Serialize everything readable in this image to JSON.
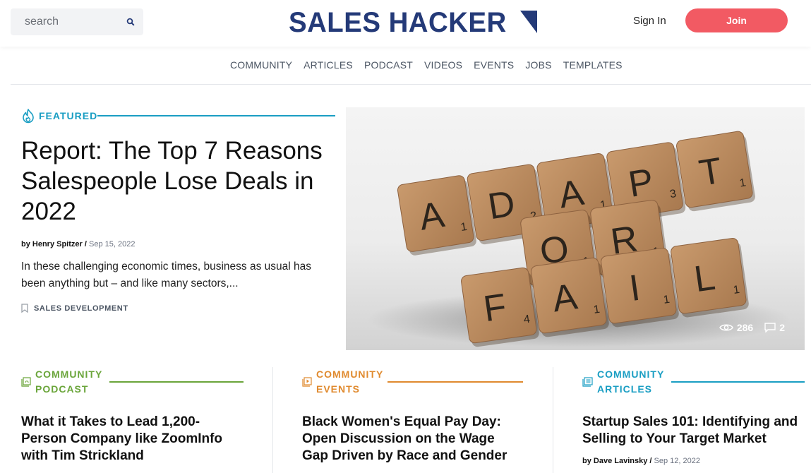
{
  "header": {
    "search_placeholder": "search",
    "logo_text": "SALES HACKER",
    "sign_in": "Sign In",
    "join": "Join"
  },
  "nav": [
    "COMMUNITY",
    "ARTICLES",
    "PODCAST",
    "VIDEOS",
    "EVENTS",
    "JOBS",
    "TEMPLATES"
  ],
  "featured": {
    "label": "FEATURED",
    "title": "Report: The Top 7 Reasons Salespeople Lose Deals in 2022",
    "author": "by Henry Spitzer",
    "date": "Sep 15, 2022",
    "excerpt": "In these challenging economic times, business as usual has been anything but – and like many sectors,...",
    "tag": "SALES DEVELOPMENT",
    "views": "286",
    "comments": "2",
    "image_tiles": {
      "row1": [
        {
          "l": "A",
          "n": "1"
        },
        {
          "l": "D",
          "n": "2"
        },
        {
          "l": "A",
          "n": "1"
        },
        {
          "l": "P",
          "n": "3"
        },
        {
          "l": "T",
          "n": "1"
        }
      ],
      "row2": [
        {
          "l": "O",
          "n": "1"
        },
        {
          "l": "R",
          "n": "1"
        }
      ],
      "row3": [
        {
          "l": "F",
          "n": "4"
        },
        {
          "l": "A",
          "n": "1"
        },
        {
          "l": "I",
          "n": "1"
        },
        {
          "l": "L",
          "n": "1"
        }
      ]
    }
  },
  "cards": [
    {
      "category_line1": "COMMUNITY",
      "category_line2": "PODCAST",
      "color": "#6aa53a",
      "title": "What it Takes to Lead 1,200-Person Company like ZoomInfo with Tim Strickland"
    },
    {
      "category_line1": "COMMUNITY",
      "category_line2": "EVENTS",
      "color": "#e08a2e",
      "title": "Black Women's Equal Pay Day: Open Discussion on the Wage Gap Driven by Race and Gender"
    },
    {
      "category_line1": "COMMUNITY",
      "category_line2": "ARTICLES",
      "color": "#1a9ec3",
      "title": "Startup Sales 101: Identifying and Selling to Your Target Market",
      "author": "by Dave Lavinsky",
      "date": "Sep 12, 2022"
    }
  ],
  "colors": {
    "brand_navy": "#243a78",
    "join_red": "#f25a63",
    "featured_blue": "#1a9ec3"
  }
}
